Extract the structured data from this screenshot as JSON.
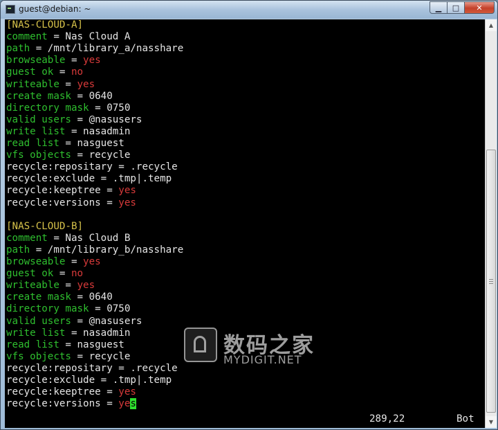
{
  "window": {
    "title": "guest@debian: ~"
  },
  "controls": {
    "minimize": "▁",
    "maximize": "□",
    "close": "✕"
  },
  "lines": [
    [
      {
        "t": "[NAS-CLOUD-A]",
        "c": "s"
      }
    ],
    [
      {
        "t": "comment",
        "c": "k"
      },
      {
        "t": " = Nas Cloud A",
        "c": "w"
      }
    ],
    [
      {
        "t": "path",
        "c": "k"
      },
      {
        "t": " = /mnt/library_a/nasshare",
        "c": "w"
      }
    ],
    [
      {
        "t": "browseable",
        "c": "k"
      },
      {
        "t": " = ",
        "c": "w"
      },
      {
        "t": "yes",
        "c": "r"
      }
    ],
    [
      {
        "t": "guest ok",
        "c": "k"
      },
      {
        "t": " = ",
        "c": "w"
      },
      {
        "t": "no",
        "c": "r"
      }
    ],
    [
      {
        "t": "writeable",
        "c": "k"
      },
      {
        "t": " = ",
        "c": "w"
      },
      {
        "t": "yes",
        "c": "r"
      }
    ],
    [
      {
        "t": "create mask",
        "c": "k"
      },
      {
        "t": " = 0640",
        "c": "w"
      }
    ],
    [
      {
        "t": "directory mask",
        "c": "k"
      },
      {
        "t": " = 0750",
        "c": "w"
      }
    ],
    [
      {
        "t": "valid users",
        "c": "k"
      },
      {
        "t": " = @nasusers",
        "c": "w"
      }
    ],
    [
      {
        "t": "write list",
        "c": "k"
      },
      {
        "t": " = nasadmin",
        "c": "w"
      }
    ],
    [
      {
        "t": "read list",
        "c": "k"
      },
      {
        "t": " = nasguest",
        "c": "w"
      }
    ],
    [
      {
        "t": "vfs objects",
        "c": "k"
      },
      {
        "t": " = recycle",
        "c": "w"
      }
    ],
    [
      {
        "t": "recycle:repositary = .recycle",
        "c": "w"
      }
    ],
    [
      {
        "t": "recycle:exclude = .tmp|.temp",
        "c": "w"
      }
    ],
    [
      {
        "t": "recycle:keeptree = ",
        "c": "w"
      },
      {
        "t": "yes",
        "c": "r"
      }
    ],
    [
      {
        "t": "recycle:versions = ",
        "c": "w"
      },
      {
        "t": "yes",
        "c": "r"
      }
    ],
    [],
    [
      {
        "t": "[NAS-CLOUD-B]",
        "c": "s"
      }
    ],
    [
      {
        "t": "comment",
        "c": "k"
      },
      {
        "t": " = Nas Cloud B",
        "c": "w"
      }
    ],
    [
      {
        "t": "path",
        "c": "k"
      },
      {
        "t": " = /mnt/library_b/nasshare",
        "c": "w"
      }
    ],
    [
      {
        "t": "browseable",
        "c": "k"
      },
      {
        "t": " = ",
        "c": "w"
      },
      {
        "t": "yes",
        "c": "r"
      }
    ],
    [
      {
        "t": "guest ok",
        "c": "k"
      },
      {
        "t": " = ",
        "c": "w"
      },
      {
        "t": "no",
        "c": "r"
      }
    ],
    [
      {
        "t": "writeable",
        "c": "k"
      },
      {
        "t": " = ",
        "c": "w"
      },
      {
        "t": "yes",
        "c": "r"
      }
    ],
    [
      {
        "t": "create mask",
        "c": "k"
      },
      {
        "t": " = 0640",
        "c": "w"
      }
    ],
    [
      {
        "t": "directory mask",
        "c": "k"
      },
      {
        "t": " = 0750",
        "c": "w"
      }
    ],
    [
      {
        "t": "valid users",
        "c": "k"
      },
      {
        "t": " = @nasusers",
        "c": "w"
      }
    ],
    [
      {
        "t": "write list",
        "c": "k"
      },
      {
        "t": " = nasadmin",
        "c": "w"
      }
    ],
    [
      {
        "t": "read list",
        "c": "k"
      },
      {
        "t": " = nasguest",
        "c": "w"
      }
    ],
    [
      {
        "t": "vfs objects",
        "c": "k"
      },
      {
        "t": " = recycle",
        "c": "w"
      }
    ],
    [
      {
        "t": "recycle:repositary = .recycle",
        "c": "w"
      }
    ],
    [
      {
        "t": "recycle:exclude = .tmp|.temp",
        "c": "w"
      }
    ],
    [
      {
        "t": "recycle:keeptree = ",
        "c": "w"
      },
      {
        "t": "yes",
        "c": "r"
      }
    ],
    [
      {
        "t": "recycle:versions = ",
        "c": "w"
      },
      {
        "t": "ye",
        "c": "r"
      },
      {
        "t": "s",
        "c": "cursor"
      }
    ]
  ],
  "status": {
    "position": "289,22",
    "scroll": "Bot"
  },
  "watermark": {
    "cn": "数码之家",
    "en": "MYDIGIT.NET"
  },
  "colors": {
    "keyword": "#2fbf2f",
    "section": "#d6c24a",
    "value": "#d83a3a",
    "cursor": "#2ee02e",
    "background": "#000000"
  }
}
